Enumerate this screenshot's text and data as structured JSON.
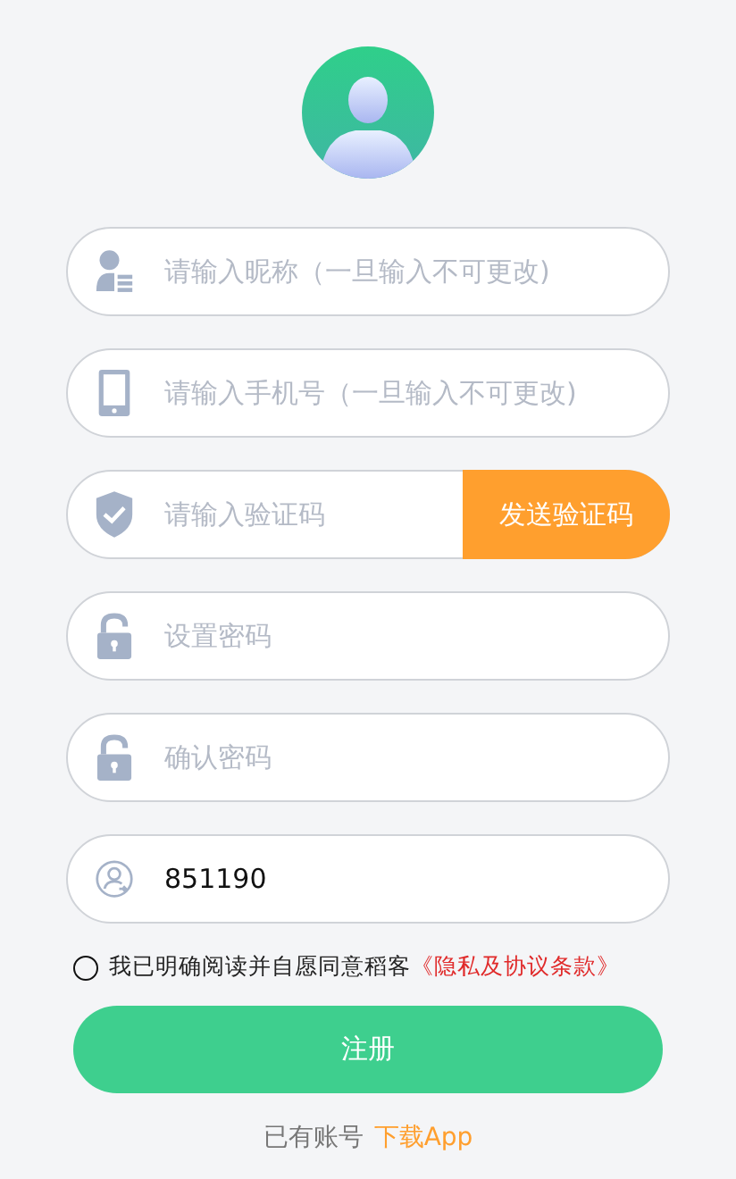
{
  "fields": [
    {
      "placeholder": "请输入昵称（一旦输入不可更改)"
    },
    {
      "placeholder": "请输入手机号（一旦输入不可更改)"
    },
    {
      "placeholder": "请输入验证码",
      "button": "发送验证码"
    },
    {
      "placeholder": "设置密码"
    },
    {
      "placeholder": "确认密码"
    },
    {
      "value": "851190"
    }
  ],
  "agreement": {
    "checked": false,
    "text": "我已明确阅读并自愿同意稻客",
    "link": "《隐私及协议条款》"
  },
  "submit": "注册",
  "footer": {
    "text": "已有账号",
    "link": "下载App"
  }
}
